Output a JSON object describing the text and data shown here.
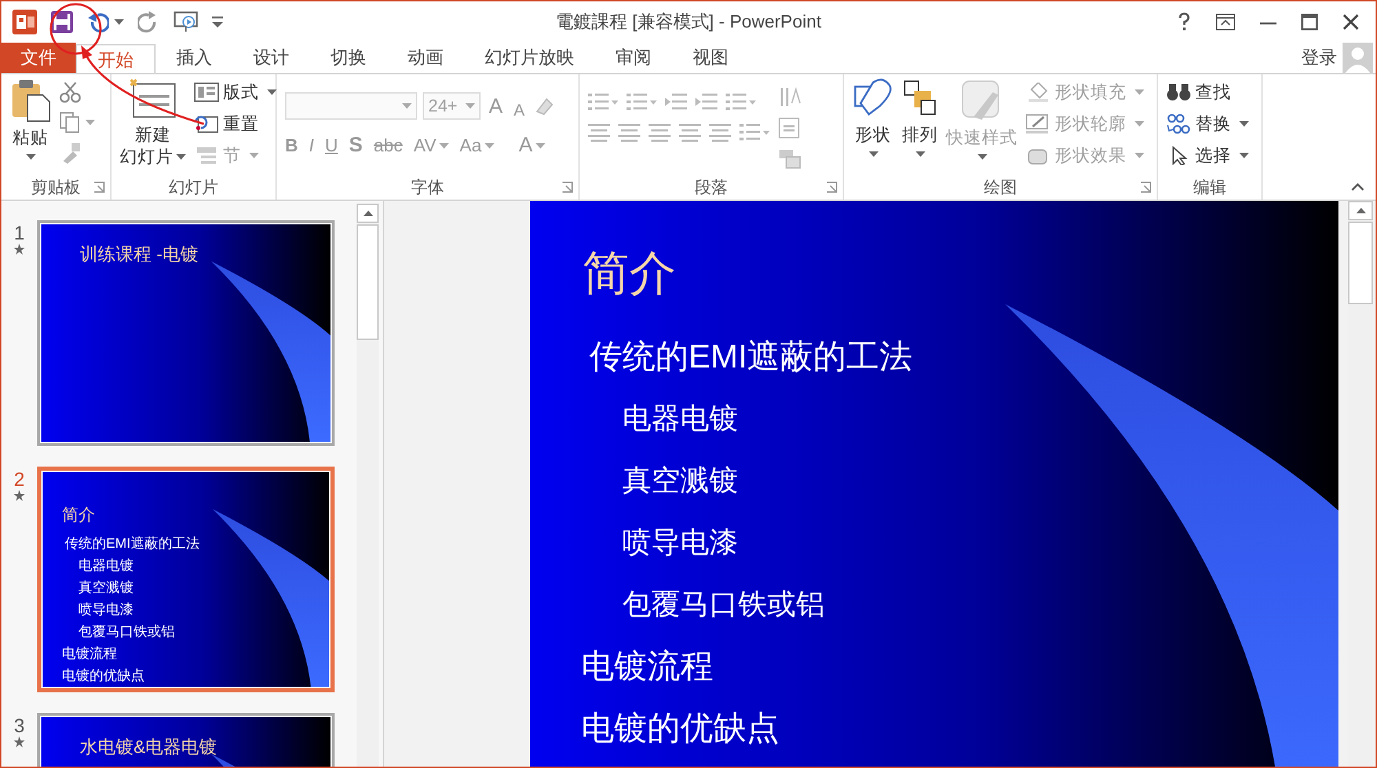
{
  "window": {
    "title": "電鍍課程 [兼容模式] - PowerPoint"
  },
  "account": {
    "label": "登录"
  },
  "tabs": [
    {
      "label": "文件",
      "kind": "backstage",
      "selected": false
    },
    {
      "label": "开始",
      "kind": "tab",
      "selected": true
    },
    {
      "label": "插入",
      "kind": "tab",
      "selected": false
    },
    {
      "label": "设计",
      "kind": "tab",
      "selected": false
    },
    {
      "label": "切换",
      "kind": "tab",
      "selected": false
    },
    {
      "label": "动画",
      "kind": "tab",
      "selected": false
    },
    {
      "label": "幻灯片放映",
      "kind": "tab",
      "selected": false
    },
    {
      "label": "审阅",
      "kind": "tab",
      "selected": false
    },
    {
      "label": "视图",
      "kind": "tab",
      "selected": false
    }
  ],
  "ribbon": {
    "groups": [
      {
        "name": "剪贴板",
        "large": [
          {
            "lines": [
              "粘贴"
            ],
            "dropdown": true,
            "disabled": false
          }
        ]
      },
      {
        "name": "幻灯片",
        "large": [
          {
            "lines": [
              "新建",
              "幻灯片"
            ],
            "dropdown": true,
            "disabled": false
          }
        ],
        "small": [
          {
            "label": "版式",
            "dropdown": true,
            "disabled": false
          },
          {
            "label": "重置",
            "dropdown": false,
            "disabled": false
          },
          {
            "label": "节",
            "dropdown": true,
            "disabled": true
          }
        ]
      },
      {
        "name": "字体",
        "fields": [
          {
            "kind": "font",
            "disabled": true
          },
          {
            "kind": "size",
            "value": "24+",
            "disabled": true
          }
        ],
        "top_buttons": [
          {
            "label": "A",
            "kind": "grow"
          },
          {
            "label": "A",
            "kind": "shrink"
          }
        ],
        "buttons": [
          {
            "label": "B",
            "kind": "bold"
          },
          {
            "label": "I",
            "kind": "italic"
          },
          {
            "label": "U",
            "kind": "underline"
          },
          {
            "label": "S",
            "kind": "shadow"
          },
          {
            "label": "abc",
            "kind": "strike"
          },
          {
            "label": "AV",
            "kind": "spacing"
          },
          {
            "label": "Aa",
            "kind": "case"
          },
          {
            "label": "A",
            "kind": "color"
          }
        ]
      },
      {
        "name": "段落"
      },
      {
        "name": "绘图",
        "large": [
          {
            "lines": [
              "形状"
            ],
            "dropdown": true,
            "disabled": false
          },
          {
            "lines": [
              "排列"
            ],
            "dropdown": true,
            "disabled": false
          },
          {
            "lines": [
              "快速样式"
            ],
            "dropdown": true,
            "disabled": true
          }
        ],
        "small": [
          {
            "label": "形状填充",
            "dropdown": true,
            "disabled": true
          },
          {
            "label": "形状轮廓",
            "dropdown": true,
            "disabled": true
          },
          {
            "label": "形状效果",
            "dropdown": true,
            "disabled": true
          }
        ]
      },
      {
        "name": "编辑",
        "small": [
          {
            "label": "查找",
            "dropdown": false,
            "disabled": false
          },
          {
            "label": "替换",
            "dropdown": true,
            "disabled": false
          },
          {
            "label": "选择",
            "dropdown": true,
            "disabled": false
          }
        ]
      }
    ]
  },
  "slides": [
    {
      "number": "1",
      "selected": false,
      "title": "训练课程 -电镀"
    },
    {
      "number": "2",
      "selected": true,
      "title": "简介",
      "items": [
        {
          "text": "传统的EMI遮蔽的工法",
          "children": [
            {
              "text": "电器电镀"
            },
            {
              "text": "真空溅镀"
            },
            {
              "text": "喷导电漆"
            },
            {
              "text": "包覆马口铁或铝"
            }
          ]
        },
        {
          "text": "电镀流程"
        },
        {
          "text": "电镀的优缺点"
        }
      ]
    },
    {
      "number": "3",
      "selected": false,
      "title": "水电镀&电器电镀"
    }
  ],
  "editor": {
    "slide": {
      "title": "简介",
      "items": [
        {
          "text": "传统的EMI遮蔽的工法",
          "children": [
            {
              "text": "电器电镀"
            },
            {
              "text": "真空溅镀"
            },
            {
              "text": "喷导电漆"
            },
            {
              "text": "包覆马口铁或铝"
            }
          ]
        },
        {
          "text": "电镀流程"
        },
        {
          "text": "电镀的优缺点"
        }
      ]
    }
  }
}
